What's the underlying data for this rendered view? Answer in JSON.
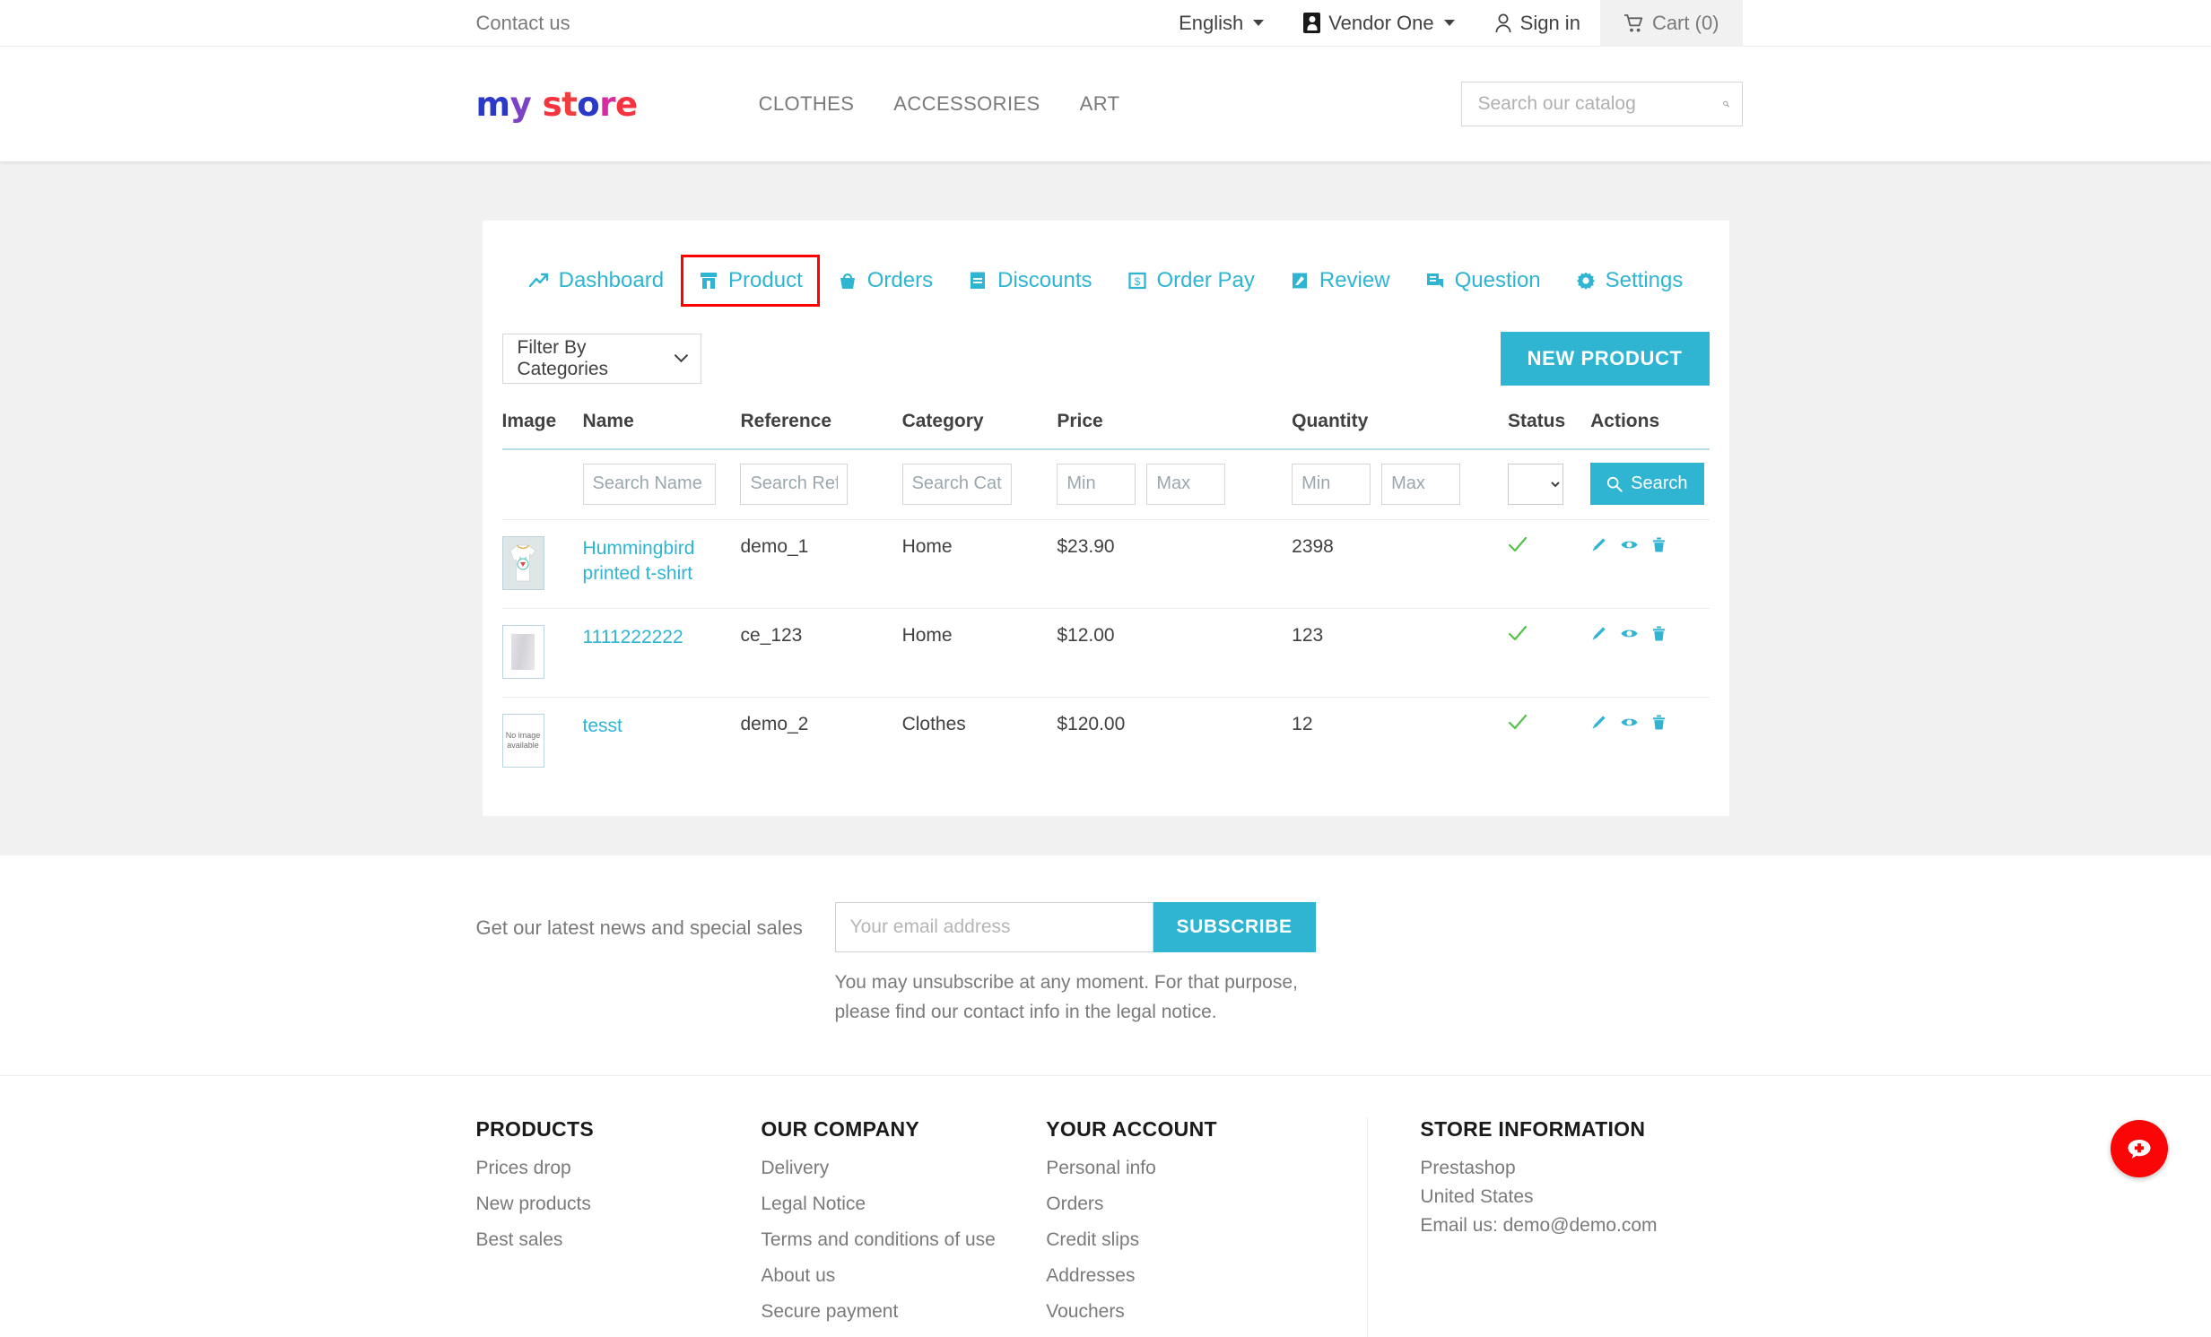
{
  "topbar": {
    "contact": "Contact us",
    "language": "English",
    "vendor": "Vendor One",
    "signin": "Sign in",
    "cart": "Cart (0)"
  },
  "header": {
    "logo": "my store",
    "nav": [
      "CLOTHES",
      "ACCESSORIES",
      "ART"
    ],
    "search_placeholder": "Search our catalog"
  },
  "tabs": [
    {
      "label": "Dashboard",
      "icon": "trend-up-icon",
      "selected": false
    },
    {
      "label": "Product",
      "icon": "product-box-icon",
      "selected": true
    },
    {
      "label": "Orders",
      "icon": "basket-icon",
      "selected": false
    },
    {
      "label": "Discounts",
      "icon": "ticket-icon",
      "selected": false
    },
    {
      "label": "Order Pay",
      "icon": "money-bill-icon",
      "selected": false
    },
    {
      "label": "Review",
      "icon": "review-pen-icon",
      "selected": false
    },
    {
      "label": "Question",
      "icon": "chat-icon",
      "selected": false
    },
    {
      "label": "Settings",
      "icon": "gear-icon",
      "selected": false
    }
  ],
  "toolbar": {
    "filter_label": "Filter By Categories",
    "new_product_label": "NEW PRODUCT"
  },
  "table": {
    "headers": [
      "Image",
      "Name",
      "Reference",
      "Category",
      "Price",
      "Quantity",
      "Status",
      "Actions"
    ],
    "filters": {
      "name_placeholder": "Search Name",
      "ref_placeholder": "Search Ref",
      "category_placeholder": "Search Category",
      "price_min_placeholder": "Min",
      "price_max_placeholder": "Max",
      "qty_min_placeholder": "Min",
      "qty_max_placeholder": "Max",
      "status_value": "",
      "search_label": "Search"
    },
    "rows": [
      {
        "image": "tshirt-thumbnail",
        "name": "Hummingbird printed t-shirt",
        "reference": "demo_1",
        "category": "Home",
        "price": "$23.90",
        "quantity": "2398",
        "status": "active"
      },
      {
        "image": "grey-placeholder-thumbnail",
        "name": "1111222222",
        "reference": "ce_123",
        "category": "Home",
        "price": "$12.00",
        "quantity": "123",
        "status": "active"
      },
      {
        "image": "no-image-thumbnail",
        "name": "tesst",
        "reference": "demo_2",
        "category": "Clothes",
        "price": "$120.00",
        "quantity": "12",
        "status": "active"
      }
    ],
    "no_image_text": "No image available"
  },
  "newsletter": {
    "label": "Get our latest news and special sales",
    "email_placeholder": "Your email address",
    "subscribe_label": "SUBSCRIBE",
    "note": "You may unsubscribe at any moment. For that purpose, please find our contact info in the legal notice."
  },
  "footer": {
    "products": {
      "title": "PRODUCTS",
      "links": [
        "Prices drop",
        "New products",
        "Best sales"
      ]
    },
    "company": {
      "title": "OUR COMPANY",
      "links": [
        "Delivery",
        "Legal Notice",
        "Terms and conditions of use",
        "About us",
        "Secure payment"
      ]
    },
    "account": {
      "title": "YOUR ACCOUNT",
      "links": [
        "Personal info",
        "Orders",
        "Credit slips",
        "Addresses",
        "Vouchers"
      ]
    },
    "store": {
      "title": "STORE INFORMATION",
      "lines": [
        "Prestashop",
        "United States",
        "Email us: demo@demo.com"
      ]
    }
  },
  "colors": {
    "accent": "#2fb5d2",
    "highlight": "#ff0000",
    "status_ok": "#55c14a",
    "fab": "#fb0606",
    "page_bg": "#f1f1f1"
  }
}
